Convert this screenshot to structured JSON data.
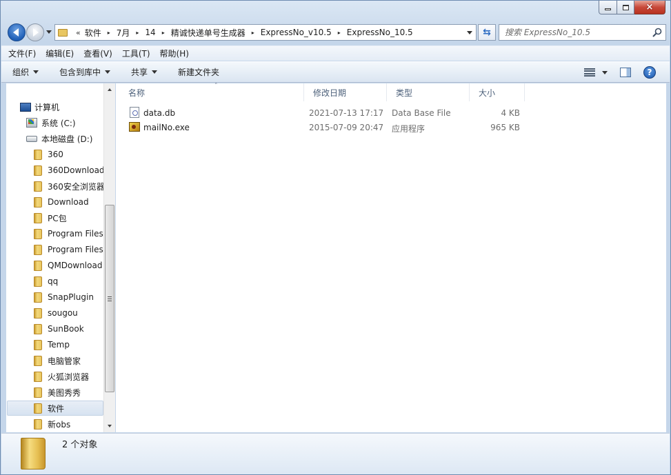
{
  "window": {
    "caption_buttons": {
      "minimize": "minimize-icon",
      "maximize": "maximize-icon",
      "close": "×"
    }
  },
  "address_bar": {
    "overflow_chevron": "«",
    "breadcrumbs": [
      "软件",
      "7月",
      "14",
      "精诚快递单号生成器",
      "ExpressNo_v10.5",
      "ExpressNo_10.5"
    ],
    "separator": "▸"
  },
  "search": {
    "placeholder": "搜索 ExpressNo_10.5"
  },
  "menubar": [
    "文件(F)",
    "编辑(E)",
    "查看(V)",
    "工具(T)",
    "帮助(H)"
  ],
  "toolbar": {
    "organize": "组织",
    "include_in_library": "包含到库中",
    "share": "共享",
    "new_folder": "新建文件夹",
    "help": "?"
  },
  "nav_pane": {
    "computer": "计算机",
    "drive_c": "系统 (C:)",
    "drive_d": "本地磁盘 (D:)",
    "folders": [
      "360",
      "360Download",
      "360安全浏览器",
      "Download",
      "PC包",
      "Program Files",
      "Program Files",
      "QMDownload",
      "qq",
      "SnapPlugin",
      "sougou",
      "SunBook",
      "Temp",
      "电脑管家",
      "火狐浏览器",
      "美图秀秀",
      "软件",
      "新obs"
    ],
    "selected_folder": "软件"
  },
  "file_list": {
    "columns": {
      "name": "名称",
      "date": "修改日期",
      "type": "类型",
      "size": "大小"
    },
    "sort_indicator": "˄",
    "rows": [
      {
        "name": "data.db",
        "date": "2021-07-13 17:17",
        "type": "Data Base File",
        "size": "4 KB",
        "icon": "database-file-icon"
      },
      {
        "name": "mailNo.exe",
        "date": "2015-07-09 20:47",
        "type": "应用程序",
        "size": "965 KB",
        "icon": "application-icon"
      }
    ]
  },
  "status_bar": {
    "text": "2 个对象"
  }
}
